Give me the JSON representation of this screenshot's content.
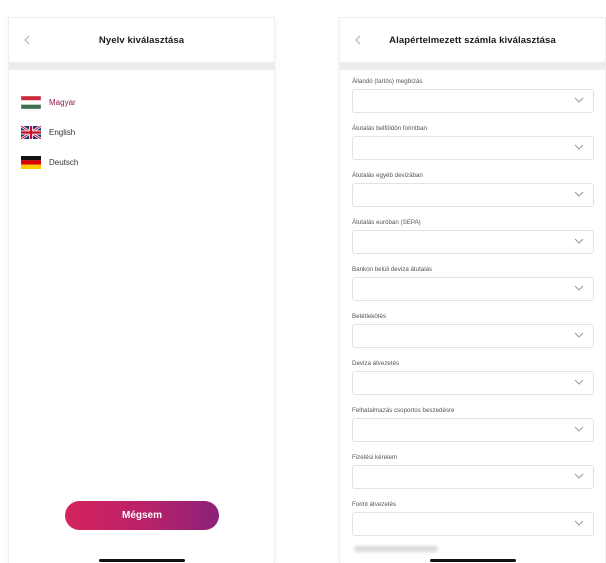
{
  "language_screen": {
    "title": "Nyelv kiválasztása",
    "languages": [
      {
        "label": "Magyar",
        "flag": "hu-flag",
        "selected": true
      },
      {
        "label": "English",
        "flag": "uk-flag",
        "selected": false
      },
      {
        "label": "Deutsch",
        "flag": "de-flag",
        "selected": false
      }
    ],
    "cancel_label": "Mégsem"
  },
  "account_screen": {
    "title": "Alapértelmezett számla kiválasztása",
    "fields": [
      {
        "label": "Állandó (tartós) megbízás",
        "value": ""
      },
      {
        "label": "Átutalás belföldön forintban",
        "value": ""
      },
      {
        "label": "Átutalás egyéb devizában",
        "value": ""
      },
      {
        "label": "Átutalás euróban (SEPA)",
        "value": ""
      },
      {
        "label": "Bankon belüli deviza átutalás",
        "value": ""
      },
      {
        "label": "Betétlekötés",
        "value": ""
      },
      {
        "label": "Deviza átvezetés",
        "value": ""
      },
      {
        "label": "Felhatalmazás csoportos beszedésre",
        "value": ""
      },
      {
        "label": "Fizetési kérelem",
        "value": ""
      },
      {
        "label": "Forint átvezetés",
        "value": ""
      }
    ]
  },
  "colors": {
    "accent": "#8e1b4e",
    "button_gradient_start": "#d4235b",
    "button_gradient_end": "#8b2178",
    "band": "#ececec"
  }
}
